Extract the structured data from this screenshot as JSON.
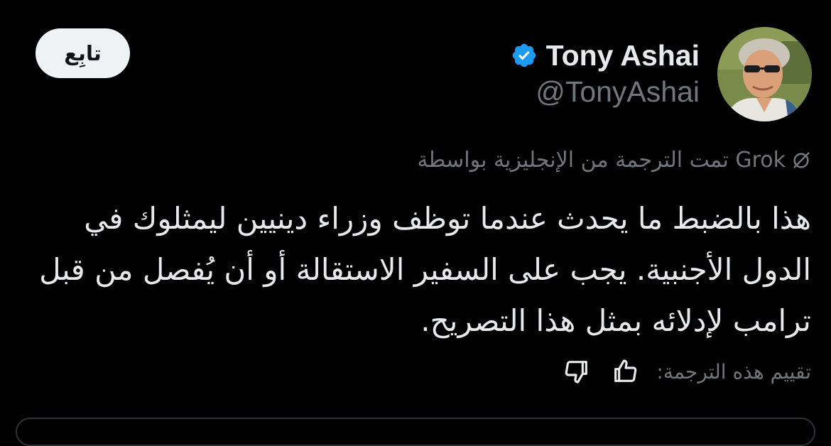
{
  "user": {
    "display_name": "Tony Ashai",
    "handle": "@TonyAshai",
    "verified": true
  },
  "follow_button": {
    "label": "تابِع"
  },
  "translation_note": {
    "text": "تمت الترجمة من الإنجليزية بواسطة Grok",
    "icon": "grok-icon"
  },
  "tweet": {
    "text": "هذا بالضبط ما يحدث عندما توظف وزراء دينيين ليمثلوك في الدول الأجنبية. يجب على السفير الاستقالة أو أن يُفصل من قبل ترامب لإدلائه بمثل هذا التصريح."
  },
  "rating": {
    "label": "تقييم هذه الترجمة:",
    "thumbs_up_icon": "thumbs-up-icon",
    "thumbs_down_icon": "thumbs-down-icon"
  },
  "colors": {
    "background": "#000000",
    "primary_text": "#e7e9ea",
    "secondary_text": "#71767b",
    "verified_badge": "#1d9bf0",
    "follow_button_bg": "#eff3f4",
    "follow_button_text": "#0f1419",
    "border": "#2f3336"
  }
}
